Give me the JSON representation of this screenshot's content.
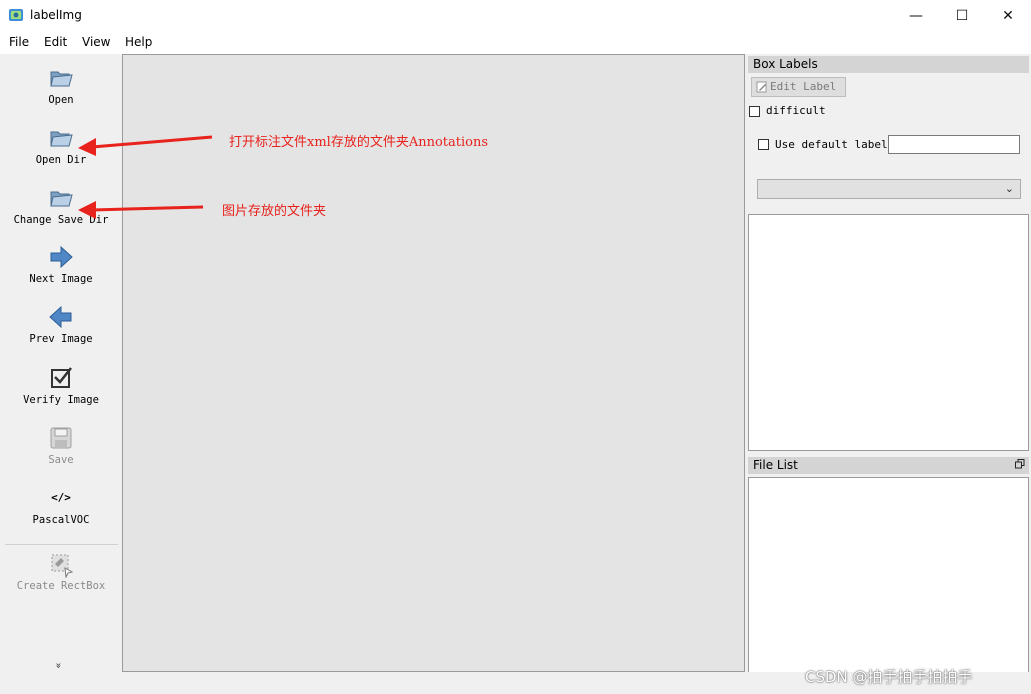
{
  "window": {
    "title": "labelImg",
    "minimize_glyph": "—",
    "maximize_glyph": "☐",
    "close_glyph": "✕"
  },
  "menu": {
    "items": [
      "File",
      "Edit",
      "View",
      "Help"
    ]
  },
  "toolbar": {
    "open": "Open",
    "open_dir": "Open Dir",
    "change_save_dir": "Change Save Dir",
    "next_image": "Next Image",
    "prev_image": "Prev Image",
    "verify_image": "Verify Image",
    "save": "Save",
    "format_icon_text": "</>",
    "format": "PascalVOC",
    "create_rectbox": "Create RectBox",
    "more_glyph": "»"
  },
  "annotations": {
    "open_dir_note": "打开标注文件xml存放的文件夹Annotations",
    "change_save_dir_note": "图片存放的文件夹",
    "color": "#e8221c"
  },
  "box_labels": {
    "title": "Box Labels",
    "edit_label": "Edit Label",
    "difficult": "difficult",
    "use_default_label": "Use default label",
    "default_label_value": "",
    "combo_value": ""
  },
  "file_list": {
    "title": "File List"
  },
  "watermark": "CSDN @拍手拍手拍拍手"
}
